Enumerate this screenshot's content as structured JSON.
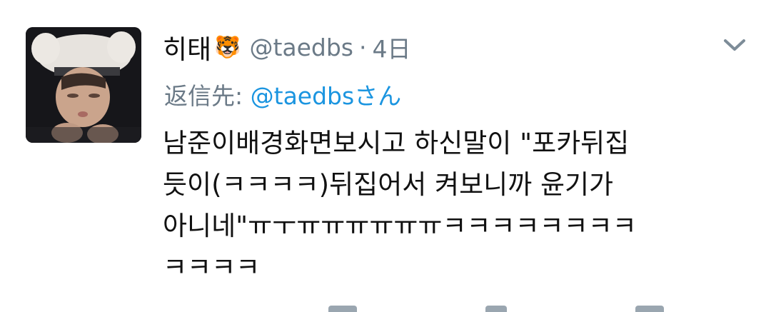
{
  "tweet": {
    "display_name": "히태",
    "emoji": "🐯",
    "handle": "@taedbs",
    "separator": "·",
    "time": "4日",
    "reply_prefix": "返信先:",
    "reply_handle": "@taedbsさん",
    "body": "남준이배경화면보시고 하신말이 \"포카뒤집\n듯이(ㅋㅋㅋㅋ)뒤집어서 켜보니까 윤기가\n아니네\"ㅠㅜㅠㅠㅠㅠㅠㅠㅋㅋㅋㅋㅋㅋㅋㅋ\nㅋㅋㅋㅋ"
  },
  "icons": {
    "avatar": "profile-photo",
    "menu": "chevron-down-icon"
  },
  "colors": {
    "text": "#111111",
    "muted": "#6b7a87",
    "link": "#1b95e0"
  }
}
